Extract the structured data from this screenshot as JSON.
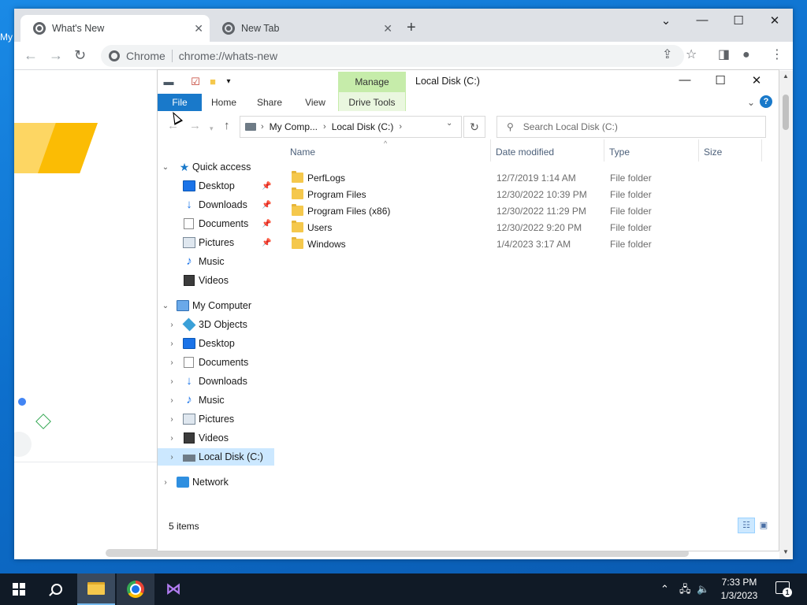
{
  "desktop": {
    "icon_label_fragment": "My"
  },
  "chrome": {
    "tabs": [
      {
        "label": "What's New",
        "active": true
      },
      {
        "label": "New Tab",
        "active": false
      }
    ],
    "omnibox": {
      "site_label": "Chrome",
      "url": "chrome://whats-new"
    }
  },
  "explorer": {
    "title": "Local Disk (C:)",
    "contextual_tab": "Manage",
    "ribbon_tabs": [
      "File",
      "Home",
      "Share",
      "View",
      "Drive Tools"
    ],
    "breadcrumb": [
      "My Comp...",
      "Local Disk (C:)"
    ],
    "search_placeholder": "Search Local Disk (C:)",
    "columns": [
      "Name",
      "Date modified",
      "Type",
      "Size"
    ],
    "files": [
      {
        "name": "PerfLogs",
        "date": "12/7/2019 1:14 AM",
        "type": "File folder"
      },
      {
        "name": "Program Files",
        "date": "12/30/2022 10:39 PM",
        "type": "File folder"
      },
      {
        "name": "Program Files (x86)",
        "date": "12/30/2022 11:29 PM",
        "type": "File folder"
      },
      {
        "name": "Users",
        "date": "12/30/2022 9:20 PM",
        "type": "File folder"
      },
      {
        "name": "Windows",
        "date": "1/4/2023 3:17 AM",
        "type": "File folder"
      }
    ],
    "nav": {
      "quick_access": {
        "label": "Quick access",
        "items": [
          "Desktop",
          "Downloads",
          "Documents",
          "Pictures",
          "Music",
          "Videos"
        ]
      },
      "my_computer": {
        "label": "My Computer",
        "items": [
          "3D Objects",
          "Desktop",
          "Documents",
          "Downloads",
          "Music",
          "Pictures",
          "Videos",
          "Local Disk (C:)"
        ]
      },
      "network": "Network"
    },
    "status": "5 items"
  },
  "taskbar": {
    "time": "7:33 PM",
    "date": "1/3/2023",
    "notification_count": "1"
  }
}
